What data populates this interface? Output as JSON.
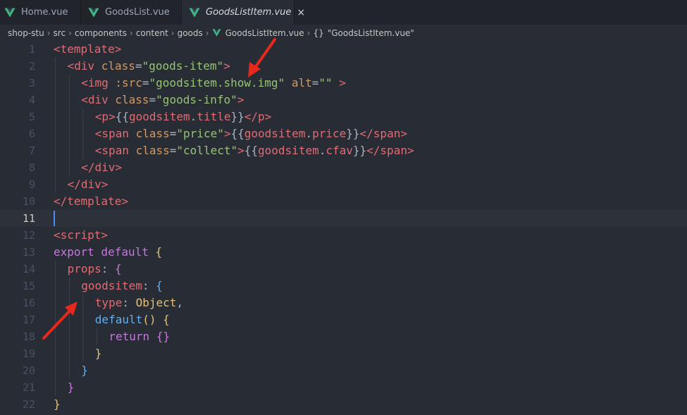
{
  "tabs": [
    {
      "label": "Home.vue",
      "active": false
    },
    {
      "label": "GoodsList.vue",
      "active": false
    },
    {
      "label": "GoodsListItem.vue",
      "active": true
    }
  ],
  "tab_close_glyph": "×",
  "breadcrumb": {
    "parts": [
      "shop-stu",
      "src",
      "components",
      "content",
      "goods",
      "GoodsListItem.vue"
    ],
    "symbol_icon": "{}",
    "symbol_label": "\"GoodsListItem.vue\""
  },
  "editor": {
    "current_line": 11,
    "line_numbers": [
      "1",
      "2",
      "3",
      "4",
      "5",
      "6",
      "7",
      "8",
      "9",
      "10",
      "11",
      "12",
      "13",
      "14",
      "15",
      "16",
      "17",
      "18",
      "19",
      "20",
      "21",
      "22"
    ],
    "lines": [
      [
        [
          "tag",
          "<template>"
        ]
      ],
      [
        [
          "tag",
          "<div "
        ],
        [
          "attr",
          "class"
        ],
        [
          "punc",
          "="
        ],
        [
          "str",
          "\"goods-item\""
        ],
        [
          "tag",
          ">"
        ]
      ],
      [
        [
          "tag",
          "<img "
        ],
        [
          "attr",
          ":src"
        ],
        [
          "punc",
          "="
        ],
        [
          "str",
          "\"goodsitem.show.img\" "
        ],
        [
          "attr",
          "alt"
        ],
        [
          "punc",
          "="
        ],
        [
          "str",
          "\"\""
        ],
        [
          "tag",
          " >"
        ]
      ],
      [
        [
          "tag",
          "<div "
        ],
        [
          "attr",
          "class"
        ],
        [
          "punc",
          "="
        ],
        [
          "str",
          "\"goods-info\""
        ],
        [
          "tag",
          ">"
        ]
      ],
      [
        [
          "tag",
          "<p>"
        ],
        [
          "punc",
          "{{"
        ],
        [
          "prop",
          "goodsitem"
        ],
        [
          "punc",
          "."
        ],
        [
          "prop",
          "title"
        ],
        [
          "punc",
          "}}"
        ],
        [
          "tag",
          "</p>"
        ]
      ],
      [
        [
          "tag",
          "<span "
        ],
        [
          "attr",
          "class"
        ],
        [
          "punc",
          "="
        ],
        [
          "str",
          "\"price\""
        ],
        [
          "tag",
          ">"
        ],
        [
          "punc",
          "{{"
        ],
        [
          "prop",
          "goodsitem"
        ],
        [
          "punc",
          "."
        ],
        [
          "prop",
          "price"
        ],
        [
          "punc",
          "}}"
        ],
        [
          "tag",
          "</span>"
        ]
      ],
      [
        [
          "tag",
          "<span "
        ],
        [
          "attr",
          "class"
        ],
        [
          "punc",
          "="
        ],
        [
          "str",
          "\"collect\""
        ],
        [
          "tag",
          ">"
        ],
        [
          "punc",
          "{{"
        ],
        [
          "prop",
          "goodsitem"
        ],
        [
          "punc",
          "."
        ],
        [
          "prop",
          "cfav"
        ],
        [
          "punc",
          "}}"
        ],
        [
          "tag",
          "</span>"
        ]
      ],
      [
        [
          "tag",
          "</div>"
        ]
      ],
      [
        [
          "tag",
          "</div>"
        ]
      ],
      [
        [
          "tag",
          "</template>"
        ]
      ],
      [],
      [
        [
          "tag",
          "<script>"
        ]
      ],
      [
        [
          "kw",
          "export default "
        ],
        [
          "brace1",
          "{"
        ]
      ],
      [
        [
          "prop",
          "props"
        ],
        [
          "punc",
          ": "
        ],
        [
          "brace2",
          "{"
        ]
      ],
      [
        [
          "prop",
          "goodsitem"
        ],
        [
          "punc",
          ": "
        ],
        [
          "brace3",
          "{"
        ]
      ],
      [
        [
          "prop",
          "type"
        ],
        [
          "punc",
          ": "
        ],
        [
          "obj",
          "Object"
        ],
        [
          "punc",
          ","
        ]
      ],
      [
        [
          "fn",
          "default"
        ],
        [
          "brace1",
          "() {"
        ]
      ],
      [
        [
          "kw",
          "return "
        ],
        [
          "brace2",
          "{}"
        ]
      ],
      [
        [
          "brace1",
          "}"
        ]
      ],
      [
        [
          "brace3",
          "}"
        ]
      ],
      [
        [
          "brace2",
          "}"
        ]
      ],
      [
        [
          "brace1",
          "}"
        ]
      ]
    ]
  },
  "colors": {
    "vue_green": "#41b883",
    "vue_dark": "#34495e",
    "arrow_red": "#e8281c"
  }
}
